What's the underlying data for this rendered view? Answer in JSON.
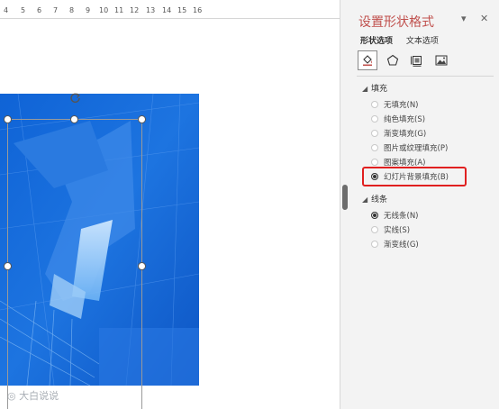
{
  "ruler": {
    "ticks": [
      "4",
      "5",
      "6",
      "7",
      "8",
      "9",
      "10",
      "11",
      "12",
      "13",
      "14",
      "15",
      "16"
    ]
  },
  "watermark": {
    "text": "大白说说"
  },
  "pane": {
    "title": "设置形状格式",
    "controls": {
      "dropdown": "▾",
      "close": "✕"
    },
    "tabs": [
      "形状选项",
      "文本选项"
    ],
    "icons": [
      "fill-line-icon",
      "effects-icon",
      "size-properties-icon",
      "picture-icon"
    ],
    "fill": {
      "heading": "填充",
      "options": [
        {
          "label": "无填充(N)",
          "selected": false
        },
        {
          "label": "纯色填充(S)",
          "selected": false
        },
        {
          "label": "渐变填充(G)",
          "selected": false
        },
        {
          "label": "图片或纹理填充(P)",
          "selected": false
        },
        {
          "label": "图案填充(A)",
          "selected": false
        },
        {
          "label": "幻灯片背景填充(B)",
          "selected": true
        }
      ]
    },
    "line": {
      "heading": "线条",
      "options": [
        {
          "label": "无线条(N)",
          "selected": true
        },
        {
          "label": "实线(S)",
          "selected": false
        },
        {
          "label": "渐变线(G)",
          "selected": false
        }
      ]
    }
  },
  "colors": {
    "title": "#c0504d",
    "highlight": "#e02020",
    "slide_blue": "#1e6fd8"
  }
}
